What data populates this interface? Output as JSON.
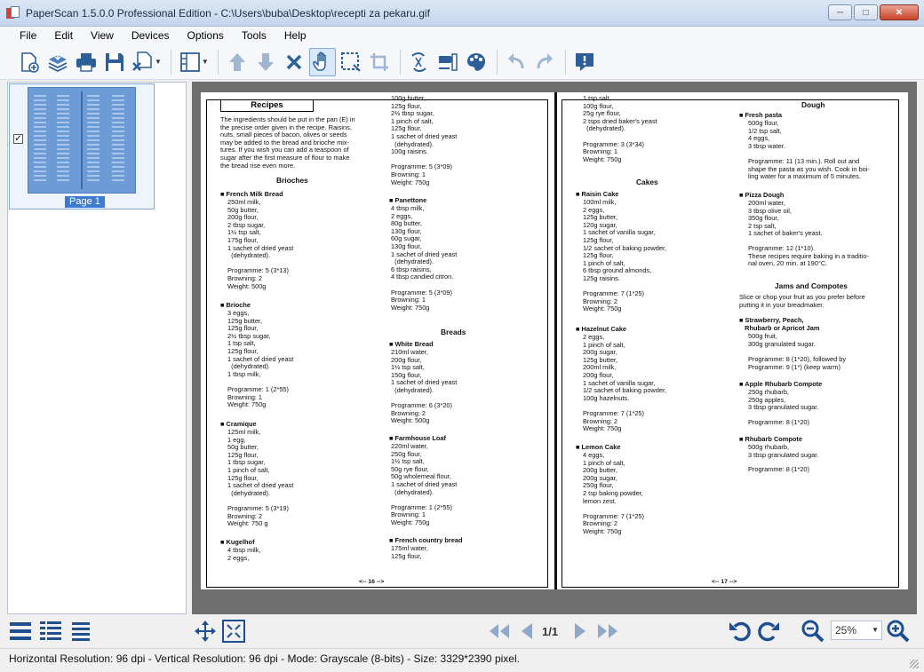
{
  "window": {
    "title": "PaperScan 1.5.0.0 Professional Edition - C:\\Users\\buba\\Desktop\\recepti za pekaru.gif",
    "minimize_icon": "minimize-icon",
    "maximize_icon": "maximize-icon",
    "close_icon": "close-icon"
  },
  "menu": [
    "File",
    "Edit",
    "View",
    "Devices",
    "Options",
    "Tools",
    "Help"
  ],
  "toolbar": {
    "buttons": [
      "new-page-icon",
      "acquire-stack-icon",
      "print-icon",
      "save-icon",
      "export-icon",
      "layout-icon",
      "move-up-icon",
      "move-down-icon",
      "delete-icon",
      "hand-tool-icon",
      "selection-icon",
      "crop-icon",
      "rotate-effect-icon",
      "filter-icon",
      "color-palette-icon",
      "undo-icon",
      "redo-icon",
      "annotation-icon"
    ]
  },
  "thumbnails": [
    {
      "label": "Page 1",
      "checked": true
    }
  ],
  "document": {
    "col1": {
      "box_title": "Recipes",
      "intro": "The ingredients should be put in the pan (E) in\nthe precise order given in the recipe. Raisins,\nnuts, small pieces of bacon, olives or seeds\nmay be added to the bread and brioche mix-\ntures. If you wish you can add a teaspoon of\nsugar after the first measure of flour to make\nthe bread rise even more.",
      "heading1": "Brioches",
      "r1_title": "■ French Milk Bread",
      "r1_body": "250ml milk,\n50g butter,\n200g flour,\n2 tbsp sugar,\n1½ tsp salt,\n175g flour,\n1 sachet of dried yeast\n  (dehydrated).\n\nProgramme: 5 (3*13)\nBrowning: 2\nWeight: 500g",
      "r2_title": "■ Brioche",
      "r2_body": "3 eggs,\n125g butter,\n125g flour,\n2½ tbsp sugar,\n1 tsp salt,\n125g flour,\n1 sachet of dried yeast\n  (dehydrated).\n1 tbsp milk,\n\nProgramme: 1 (2*55)\nBrowning: 1\nWeight: 750g",
      "r3_title": "■ Cramique",
      "r3_body": "125ml milk,\n1 egg,\n50g butter,\n125g flour,\n1 tbsp sugar,\n1 pinch of salt,\n125g flour,\n1 sachet of dried yeast\n  (dehydrated).\n\nProgramme: 5 (3*19)\nBrowning: 2\nWeight: 750 g",
      "r4_title": "■ Kugelhof",
      "r4_body": "4 tbsp milk,\n2 eggs,",
      "page_number": "<-- 16 -->"
    },
    "col2": {
      "top_body": "100g butter,\n125g flour,\n2½ tbsp sugar,\n1 pinch of salt,\n125g flour,\n1 sachet of dried yeast\n  (dehydrated).\n100g raisins.\n\nProgramme: 5 (3*09)\nBrowning: 1\nWeight: 750g",
      "r1_title": "■ Panettone",
      "r1_body": "4 tbsp milk,\n2 eggs,\n80g butter,\n130g flour,\n60g sugar,\n130g flour,\n1 sachet of dried yeast\n  (dehydrated).\n6 tbsp raisins,\n4 tbsp candied citron.\n\nProgramme: 5 (3*09)\nBrowning: 1\nWeight: 750g",
      "heading": "Breads",
      "r2_title": "■ White Bread",
      "r2_body": "210ml water,\n200g flour,\n1½ tsp salt,\n150g flour,\n1 sachet of dried yeast\n  (dehydrated).\n\nProgramme: 6 (3*20)\nBrowning: 2\nWeight: 500g",
      "r3_title": "■ Farmhouse Loaf",
      "r3_body": "220ml water,\n250g flour,\n1½ tsp salt,\n50g rye flour,\n50g wholemeal flour,\n1 sachet of dried yeast\n  (dehydrated).\n\nProgramme: 1 (2*55)\nBrowning: 1\nWeight: 750g",
      "r4_title": "■ French country bread",
      "r4_body": "175ml water,\n125g flour,"
    },
    "col3": {
      "top_body": "1 tsp salt,\n100g flour,\n25g rye flour,\n2 tsps dried baker's yeast\n  (dehydrated).\n\nProgramme: 3 (3*34)\nBrowning: 1\nWeight: 750g",
      "heading": "Cakes",
      "r1_title": "■ Raisin Cake",
      "r1_body": "100ml milk,\n2 eggs,\n125g butter,\n120g sugar,\n1 sachet of vanilla sugar,\n125g flour,\n1/2 sachet of baking powder,\n125g flour,\n1 pinch of salt,\n6 tbsp ground almonds,\n125g raisins.\n\nProgramme: 7 (1*25)\nBrowning: 2\nWeight: 750g",
      "r2_title": "■ Hazelnut Cake",
      "r2_body": "2 eggs,\n1 pinch of salt,\n200g sugar,\n125g butter,\n200ml milk,\n200g flour,\n1 sachet of vanilla sugar,\n1/2 sachet of baking powder,\n100g hazelnuts.\n\nProgramme: 7 (1*25)\nBrowning: 2\nWeight: 750g",
      "r3_title": "■ Lemon Cake",
      "r3_body": "4 eggs,\n1 pinch of salt,\n200g butter,\n200g sugar,\n250g flour,\n2 tsp baking powder,\nlemon zest.\n\nProgramme: 7 (1*25)\nBrowning: 2\nWeight: 750g",
      "page_number": "<-- 17 -->"
    },
    "col4": {
      "heading1": "Dough",
      "r1_title": "■ Fresh pasta",
      "r1_body": "500g flour,\n1/2 tsp salt,\n4 eggs,\n3 tbsp water.",
      "r1_note": "Programme: 11 (13 min.). Roll out and\nshape the pasta as you wish. Cook in boi-\nling water for a maximum of 5 minutes.",
      "r2_title": "■ Pizza Dough",
      "r2_body": "200ml water,\n3 tbsp olive oil,\n350g flour,\n2 tsp salt,\n1 sachet of baker's yeast.",
      "r2_note": "Programme: 12 (1*10).\nThese recipes require baking in a traditio-\nnal oven, 20 min. at 190°C.",
      "heading2": "Jams and Compotes",
      "intro2": "Slice or chop your fruit as you prefer before\nputting it in your breadmaker.",
      "r3_title": "■ Strawberry, Peach,\n   Rhubarb or Apricot Jam",
      "r3_body": "500g fruit,\n300g granulated sugar.",
      "r3_note": "Programme: 8 (1*20), followed by\nProgramme: 9 (1*) (keep warm)",
      "r4_title": "■ Apple Rhubarb Compote",
      "r4_body": "250g rhubarb,\n250g apples,\n3 tbsp granulated sugar.",
      "r4_note": "Programme: 8 (1*20)",
      "r5_title": "■ Rhubarb Compote",
      "r5_body": "500g rhubarb,\n3 tbsp granulated sugar.",
      "r5_note": "Programme: 8 (1*20)"
    }
  },
  "navigation": {
    "page_indicator": "1/1",
    "zoom": "25%"
  },
  "status": {
    "text": "Horizontal Resolution:  96 dpi - Vertical Resolution:  96 dpi - Mode: Grayscale (8-bits) - Size: 3329*2390 pixel."
  }
}
